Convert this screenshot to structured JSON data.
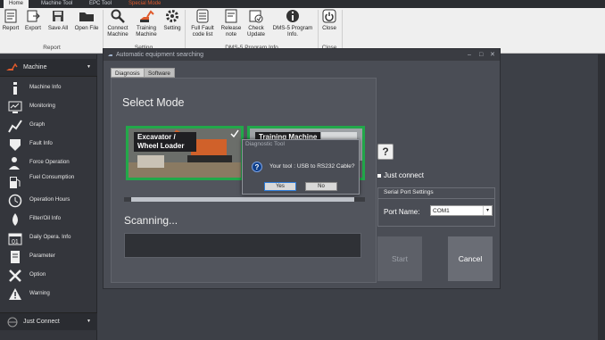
{
  "tabs": [
    "Home",
    "Machine Tool",
    "EPC Tool",
    "Special Mode"
  ],
  "ribbon": {
    "buttons": [
      "Report",
      "Export",
      "Save All",
      "Open File",
      "Connect Machine",
      "Training Machine",
      "Setting",
      "Full Fault code list",
      "Release note",
      "Check Update",
      "DMS-5 Program Info.",
      "Close"
    ],
    "groups": [
      "Report",
      "Setting",
      "DMS-5 Program Info",
      "Close"
    ]
  },
  "sidebar": {
    "header": "Machine",
    "items": [
      "Machine Info",
      "Monitoring",
      "Graph",
      "Fault Info",
      "Force Operation",
      "Fuel Consumption",
      "Operation Hours",
      "Filter/Oil Info",
      "Daily Opera. Info",
      "Parameter",
      "Option",
      "Warning"
    ],
    "footer": "Just Connect"
  },
  "window": {
    "title": "Automatic equipment searching",
    "tabs": [
      "Diagnosis",
      "Software Update"
    ],
    "select_title": "Select Mode",
    "mode_cards": [
      "Excavator / Wheel Loader",
      "Training Machine"
    ],
    "scanning": "Scanning...",
    "help_label": "?",
    "just_connect": "Just connect",
    "serial_title": "Serial Port Settings",
    "port_label": "Port Name:",
    "port_value": "COM1",
    "start": "Start",
    "cancel": "Cancel"
  },
  "dialog": {
    "title": "Diagnostic Tool",
    "message": "Your tool : USB to RS232 Cable?",
    "yes": "Yes",
    "no": "No"
  },
  "colors": {
    "accent_green": "#22a84a",
    "special_mode": "#e05a2c"
  }
}
